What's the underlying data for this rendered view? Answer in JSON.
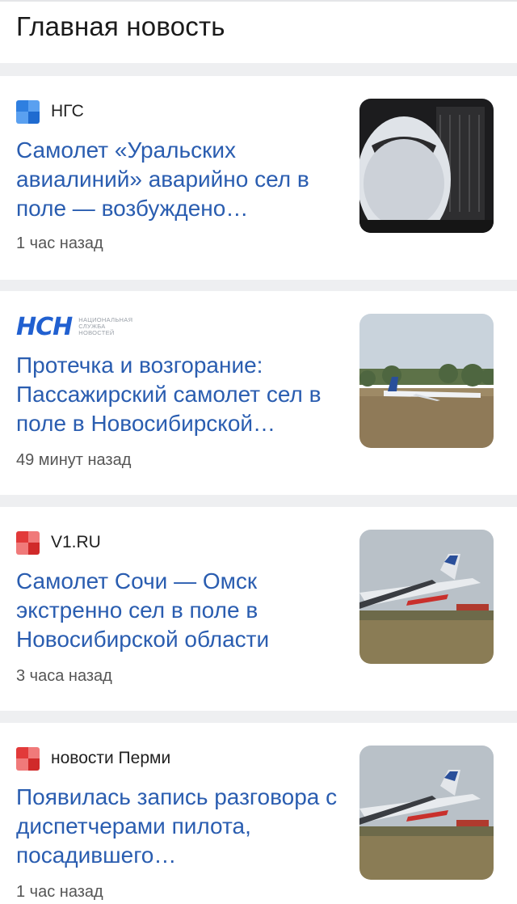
{
  "header": {
    "title": "Главная новость"
  },
  "articles": [
    {
      "source": "НГС",
      "source_icon": "ngs-blue-square-icon",
      "headline": "Самолет «Уральских авиалиний» аварийно сел в поле — возбуждено…",
      "time": "1 час назад",
      "thumbnail": "airplane-nose-closeup-image"
    },
    {
      "source": "НСН",
      "source_sub": "Национальная служба новостей",
      "source_icon": "nsn-logo",
      "headline": "Протечка и возгорание: Пассажирский самолет сел в поле в Новосибирской…",
      "time": "49 минут назад",
      "thumbnail": "airplane-in-field-image"
    },
    {
      "source": "V1.RU",
      "source_icon": "v1-red-square-icon",
      "headline": "Самолет Сочи — Омск экстренно сел в поле в Новосибирской области",
      "time": "3 часа назад",
      "thumbnail": "airplane-wing-field-image"
    },
    {
      "source": "новости Перми",
      "source_icon": "perm-red-square-icon",
      "headline": "Появилась запись разговора с диспетчерами пилота, посадившего…",
      "time": "1 час назад",
      "thumbnail": "airplane-wing-field-image"
    }
  ],
  "colors": {
    "headline": "#2a5db0",
    "ngs_blue": "#2f7fe0",
    "red_icon": "#e23a3a",
    "background": "#eeeff1"
  }
}
